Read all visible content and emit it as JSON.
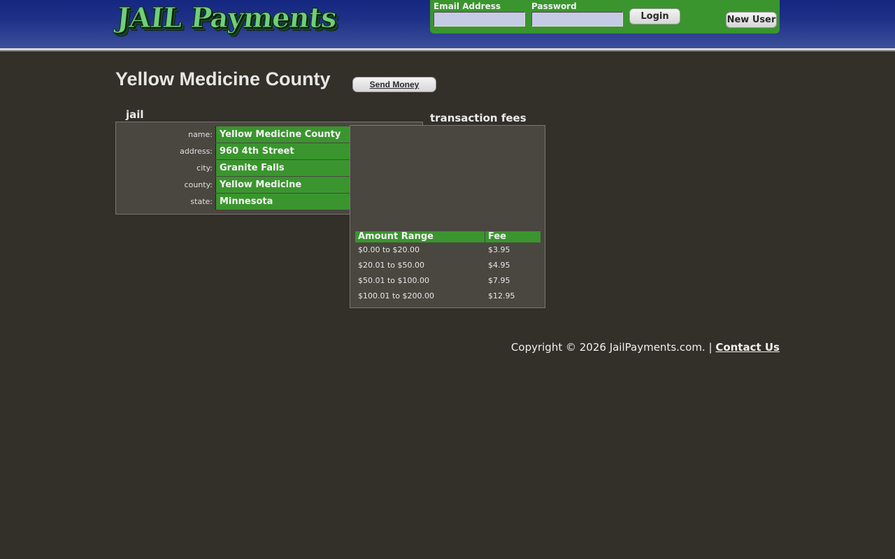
{
  "header": {
    "logo_text": "JAIL Payments",
    "email_label": "Email Address",
    "password_label": "Password",
    "email_value": "",
    "password_value": "",
    "login_label": "Login",
    "new_user_label": "New User"
  },
  "page": {
    "title": "Yellow Medicine County",
    "send_money_label": "Send Money"
  },
  "jail": {
    "section_label": "jail",
    "rows": [
      {
        "key": "name:",
        "value": "Yellow Medicine County"
      },
      {
        "key": "address:",
        "value": "960 4th Street"
      },
      {
        "key": "city:",
        "value": "Granite Falls"
      },
      {
        "key": "county:",
        "value": "Yellow Medicine"
      },
      {
        "key": "state:",
        "value": "Minnesota"
      }
    ]
  },
  "fees": {
    "section_label": "transaction fees",
    "columns": [
      "Amount Range",
      "Fee"
    ],
    "rows": [
      {
        "range": "$0.00 to $20.00",
        "fee": "$3.95"
      },
      {
        "range": "$20.01 to $50.00",
        "fee": "$4.95"
      },
      {
        "range": "$50.01 to $100.00",
        "fee": "$7.95"
      },
      {
        "range": "$100.01 to $200.00",
        "fee": "$12.95"
      }
    ]
  },
  "footer": {
    "copyright": "Copyright © 2026 JailPayments.com. |",
    "contact_label": "Contact Us"
  },
  "colors": {
    "header_blue": "#142781",
    "accent_green": "#3a952e",
    "background": "#332f29",
    "panel": "#4a4640"
  }
}
